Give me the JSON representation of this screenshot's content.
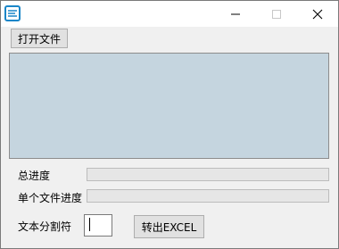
{
  "titlebar": {
    "title": ""
  },
  "toolbar": {
    "open_file_label": "打开文件"
  },
  "progress": {
    "total_label": "总进度",
    "total_value": 0,
    "single_label": "单个文件进度",
    "single_value": 0
  },
  "separator": {
    "label": "文本分割符",
    "value": ""
  },
  "actions": {
    "export_label": "转出EXCEL"
  },
  "colors": {
    "panel": "#c5d5df",
    "app_icon": "#1a86c8"
  }
}
